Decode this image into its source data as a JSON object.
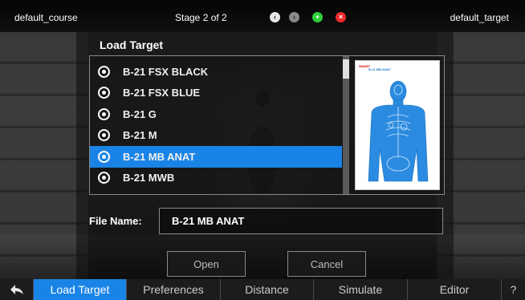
{
  "top_bar": {
    "course": "default_course",
    "stage": "Stage 2 of 2",
    "target": "default_target",
    "controls": {
      "prev_icon": "‹",
      "next_icon": "›",
      "add_icon": "+",
      "close_icon": "×"
    }
  },
  "dialog": {
    "title": "Load Target",
    "targets": [
      {
        "label": "B-21 FSX BLACK",
        "selected": false
      },
      {
        "label": "B-21 FSX BLUE",
        "selected": false
      },
      {
        "label": "B-21 G",
        "selected": false
      },
      {
        "label": "B-21 M",
        "selected": false
      },
      {
        "label": "B-21 MB ANAT",
        "selected": true
      },
      {
        "label": "B-21 MWB",
        "selected": false
      }
    ],
    "preview": {
      "brand": "SMART",
      "title": "B-21 MB ANAT",
      "target_color": "#2a8be0"
    },
    "file_name_label": "File Name:",
    "file_name_value": "B-21 MB ANAT",
    "open_label": "Open",
    "cancel_label": "Cancel"
  },
  "tabs": {
    "back_icon": "back-arrow-icon",
    "items": [
      "Load Target",
      "Preferences",
      "Distance",
      "Simulate",
      "Editor"
    ],
    "help_label": "?",
    "active": "Load Target"
  },
  "colors": {
    "accent": "#1a84e6",
    "add": "#2fcf3a",
    "close": "#ee2b2b"
  }
}
